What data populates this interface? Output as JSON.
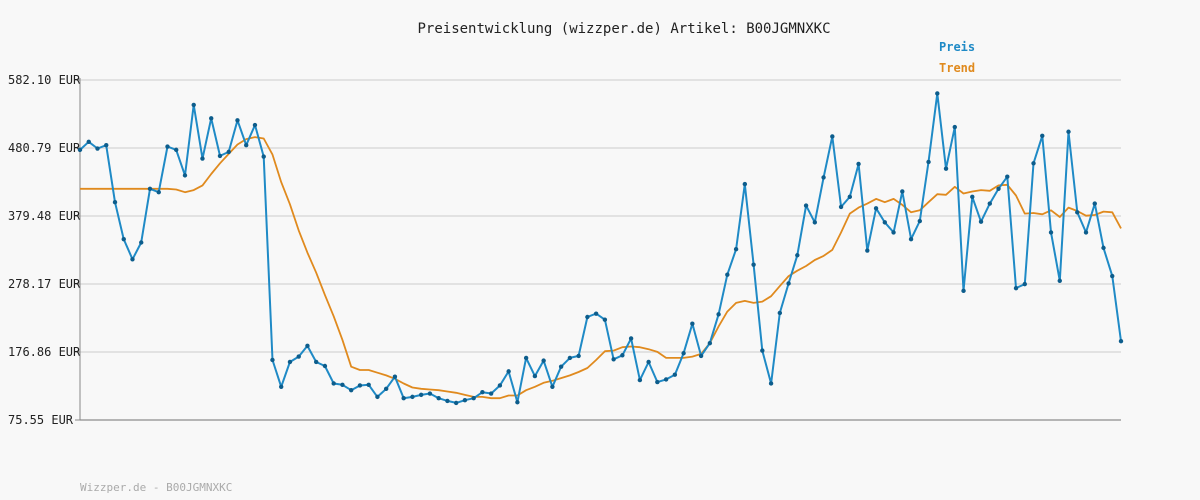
{
  "chart_data": {
    "type": "line",
    "title": "Preisentwicklung (wizzper.de) Artikel: B00JGMNXKC",
    "footer": "Wizzper.de - B00JGMNXKC",
    "legend_placement": "top-right",
    "grid": true,
    "ylim": [
      75.55,
      582.1
    ],
    "y_ticks": [
      "582.10 EUR",
      "480.79 EUR",
      "379.48 EUR",
      "278.17 EUR",
      "176.86 EUR",
      "75.55 EUR"
    ],
    "y_tick_values": [
      582.1,
      480.79,
      379.48,
      278.17,
      176.86,
      75.55
    ],
    "colors": {
      "Preis": "#1f8ac6",
      "Trend": "#e08a1e",
      "grid": "#e2e2e2",
      "axis": "#888888"
    },
    "series": [
      {
        "name": "Preis",
        "values": [
          478,
          490,
          480,
          485,
          400,
          345,
          315,
          340,
          420,
          415,
          483,
          478,
          440,
          545,
          465,
          525,
          469,
          475,
          522,
          485,
          515,
          468,
          165,
          125,
          162,
          170,
          186,
          162,
          156,
          130,
          128,
          120,
          127,
          128,
          110,
          122,
          140,
          108,
          110,
          113,
          115,
          108,
          104,
          101,
          105,
          108,
          117,
          115,
          127,
          148,
          102,
          168,
          141,
          164,
          125,
          155,
          168,
          171,
          229,
          234,
          225,
          166,
          172,
          197,
          135,
          162,
          132,
          136,
          143,
          175,
          219,
          171,
          190,
          233,
          292,
          330,
          427,
          307,
          179,
          130,
          235,
          279,
          321,
          395,
          370,
          437,
          498,
          393,
          408,
          457,
          328,
          391,
          370,
          355,
          416,
          345,
          372,
          460,
          562,
          450,
          512,
          268,
          408,
          371,
          398,
          420,
          438,
          272,
          278,
          458,
          499,
          355,
          283,
          505,
          385,
          355,
          398,
          332,
          290,
          193
        ]
      },
      {
        "name": "Trend",
        "values": [
          420,
          420,
          420,
          420,
          420,
          420,
          420,
          420,
          420,
          420,
          420,
          419,
          415,
          418,
          425,
          442,
          458,
          472,
          486,
          494,
          497,
          495,
          471,
          430,
          397,
          358,
          325,
          295,
          262,
          230,
          195,
          155,
          150,
          150,
          146,
          142,
          137,
          130,
          124,
          122,
          121,
          120,
          118,
          116,
          113,
          110,
          110,
          108,
          108,
          112,
          112,
          120,
          125,
          131,
          134,
          138,
          142,
          147,
          153,
          165,
          178,
          179,
          184,
          185,
          184,
          181,
          177,
          168,
          168,
          168,
          170,
          174,
          190,
          215,
          237,
          250,
          253,
          250,
          252,
          260,
          275,
          290,
          298,
          305,
          314,
          320,
          329,
          355,
          383,
          392,
          398,
          405,
          400,
          405,
          396,
          385,
          388,
          400,
          412,
          411,
          423,
          413,
          416,
          418,
          417,
          425,
          426,
          410,
          383,
          384,
          382,
          388,
          378,
          392,
          387,
          380,
          381,
          386,
          385,
          361
        ]
      }
    ]
  }
}
